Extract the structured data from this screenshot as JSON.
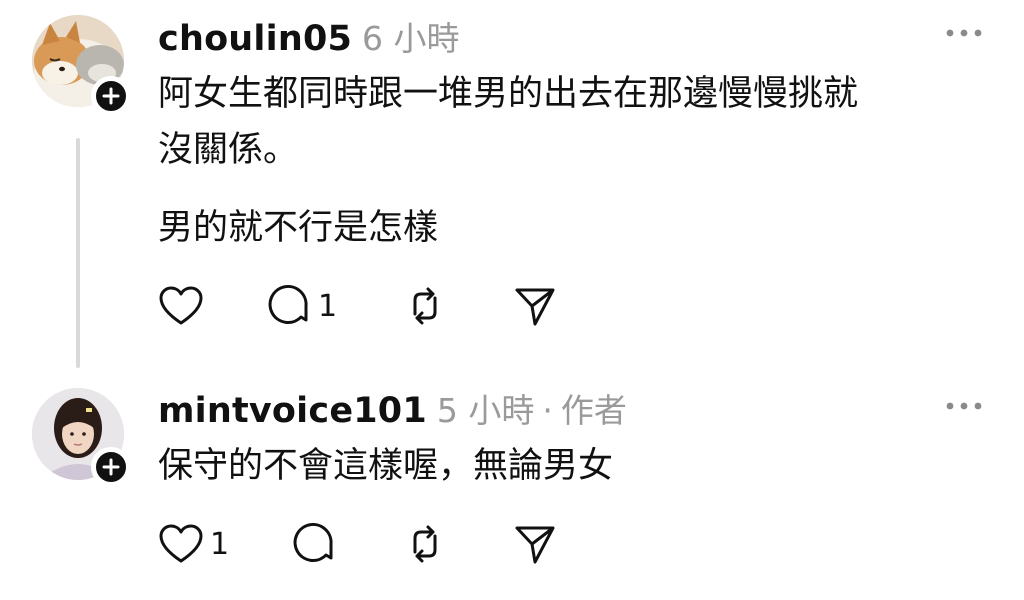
{
  "posts": [
    {
      "username": "choulin05",
      "time": "6 小時",
      "lines": [
        "阿女生都同時跟一堆男的出去在那邊慢慢挑就",
        "沒關係。"
      ],
      "paragraph2": "男的就不行是怎樣",
      "like_count": "",
      "reply_count": "1",
      "avatar_icon": "shiba-dog-avatar",
      "has_thread_line": true
    },
    {
      "username": "mintvoice101",
      "time": "5 小時",
      "separator": "·",
      "tag": "作者",
      "lines": [
        "保守的不會這樣喔，無論男女"
      ],
      "like_count": "1",
      "reply_count": "",
      "avatar_icon": "user-photo-avatar",
      "has_thread_line": false
    }
  ],
  "icons": {
    "more": "more-dots-icon",
    "like": "heart-icon",
    "reply": "comment-icon",
    "repost": "repost-icon",
    "share": "send-icon",
    "follow": "plus-icon"
  },
  "colors": {
    "text": "#111111",
    "muted": "#9a9a9a",
    "thread_line": "#d9d9d9"
  }
}
